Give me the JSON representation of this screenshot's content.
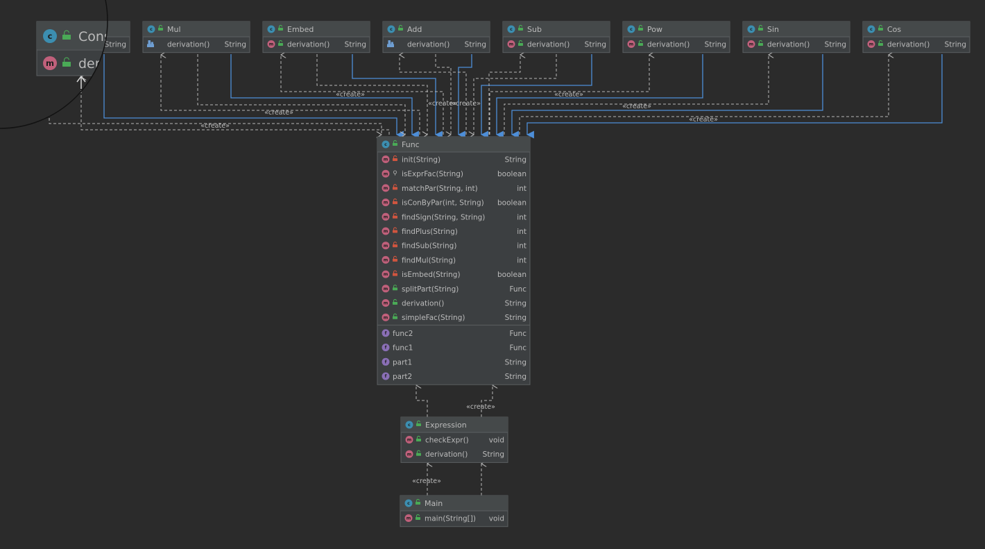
{
  "labels": {
    "create": "«create»"
  },
  "colors": {
    "background": "#2b2b2b",
    "box_bg": "#3c3f41",
    "box_header": "#45494a",
    "border": "#5b5f61",
    "text": "#bbbbbb",
    "type_text": "#bbbbbb",
    "dashed_edge": "#b7b7b7",
    "solid_edge": "#4d8ed8",
    "class_icon": "#3c8eb0",
    "method_icon": "#c0607b",
    "field_icon": "#8a6fb6",
    "public_lock": "#4aaa56",
    "private_lock": "#d0553f"
  },
  "classes": [
    {
      "id": "cons",
      "name": "Cons",
      "icon": "class-icon",
      "methods": [
        {
          "name": "der",
          "type": "String",
          "icon": "method-icon",
          "access": "public"
        }
      ],
      "fields": []
    },
    {
      "id": "mul",
      "name": "Mul",
      "icon": "class-icon",
      "methods": [
        {
          "name": "derivation()",
          "type": "String",
          "icon": "override-icon",
          "access": "none"
        }
      ],
      "fields": []
    },
    {
      "id": "embed",
      "name": "Embed",
      "icon": "class-icon",
      "methods": [
        {
          "name": "derivation()",
          "type": "String",
          "icon": "method-icon",
          "access": "public"
        }
      ],
      "fields": []
    },
    {
      "id": "add",
      "name": "Add",
      "icon": "class-icon",
      "methods": [
        {
          "name": "derivation()",
          "type": "String",
          "icon": "override-icon",
          "access": "none"
        }
      ],
      "fields": []
    },
    {
      "id": "sub",
      "name": "Sub",
      "icon": "class-icon",
      "methods": [
        {
          "name": "derivation()",
          "type": "String",
          "icon": "method-icon",
          "access": "public"
        }
      ],
      "fields": []
    },
    {
      "id": "pow",
      "name": "Pow",
      "icon": "class-icon",
      "methods": [
        {
          "name": "derivation()",
          "type": "String",
          "icon": "method-icon",
          "access": "public"
        }
      ],
      "fields": []
    },
    {
      "id": "sin",
      "name": "Sin",
      "icon": "class-icon",
      "methods": [
        {
          "name": "derivation()",
          "type": "String",
          "icon": "method-icon",
          "access": "public"
        }
      ],
      "fields": []
    },
    {
      "id": "cos",
      "name": "Cos",
      "icon": "class-icon",
      "methods": [
        {
          "name": "derivation()",
          "type": "String",
          "icon": "method-icon",
          "access": "public"
        }
      ],
      "fields": []
    },
    {
      "id": "func",
      "name": "Func",
      "icon": "class-icon",
      "methods": [
        {
          "name": "init(String)",
          "type": "String",
          "icon": "method-icon",
          "access": "private"
        },
        {
          "name": "isExprFac(String)",
          "type": "boolean",
          "icon": "method-icon",
          "access": "package"
        },
        {
          "name": "matchPar(String, int)",
          "type": "int",
          "icon": "method-icon",
          "access": "private"
        },
        {
          "name": "isConByPar(int, String)",
          "type": "boolean",
          "icon": "method-icon",
          "access": "private"
        },
        {
          "name": "findSign(String, String)",
          "type": "int",
          "icon": "method-icon",
          "access": "private"
        },
        {
          "name": "findPlus(String)",
          "type": "int",
          "icon": "method-icon",
          "access": "private"
        },
        {
          "name": "findSub(String)",
          "type": "int",
          "icon": "method-icon",
          "access": "private"
        },
        {
          "name": "findMul(String)",
          "type": "int",
          "icon": "method-icon",
          "access": "private"
        },
        {
          "name": "isEmbed(String)",
          "type": "boolean",
          "icon": "method-icon",
          "access": "private"
        },
        {
          "name": "splitPart(String)",
          "type": "Func",
          "icon": "method-icon",
          "access": "public"
        },
        {
          "name": "derivation()",
          "type": "String",
          "icon": "method-icon",
          "access": "public"
        },
        {
          "name": "simpleFac(String)",
          "type": "String",
          "icon": "method-icon",
          "access": "public"
        }
      ],
      "fields": [
        {
          "name": "func2",
          "type": "Func",
          "icon": "field-icon"
        },
        {
          "name": "func1",
          "type": "Func",
          "icon": "field-icon"
        },
        {
          "name": "part1",
          "type": "String",
          "icon": "field-icon"
        },
        {
          "name": "part2",
          "type": "String",
          "icon": "field-icon"
        }
      ]
    },
    {
      "id": "expression",
      "name": "Expression",
      "icon": "class-icon",
      "methods": [
        {
          "name": "checkExpr()",
          "type": "void",
          "icon": "method-icon",
          "access": "public"
        },
        {
          "name": "derivation()",
          "type": "String",
          "icon": "method-icon",
          "access": "public"
        }
      ],
      "fields": []
    },
    {
      "id": "main",
      "name": "Main",
      "icon": "main-class-icon",
      "methods": [
        {
          "name": "main(String[])",
          "type": "void",
          "icon": "method-icon",
          "access": "public"
        }
      ],
      "fields": []
    }
  ],
  "edges": [
    {
      "kind": "solid",
      "from": "cons",
      "to": "func",
      "label": false
    },
    {
      "kind": "dashed",
      "from": "cons",
      "to": "func",
      "label": true
    },
    {
      "kind": "dashed",
      "from": "func",
      "to": "cons",
      "label": false
    },
    {
      "kind": "solid",
      "from": "mul",
      "to": "func",
      "label": false
    },
    {
      "kind": "dashed",
      "from": "mul",
      "to": "func",
      "label": false
    },
    {
      "kind": "dashed",
      "from": "func",
      "to": "mul",
      "label": true
    },
    {
      "kind": "solid",
      "from": "embed",
      "to": "func",
      "label": false
    },
    {
      "kind": "dashed",
      "from": "embed",
      "to": "func",
      "label": false
    },
    {
      "kind": "dashed",
      "from": "func",
      "to": "embed",
      "label": true
    },
    {
      "kind": "solid",
      "from": "add",
      "to": "func",
      "label": false
    },
    {
      "kind": "dashed",
      "from": "add",
      "to": "func",
      "label": true
    },
    {
      "kind": "dashed",
      "from": "func",
      "to": "add",
      "label": false
    },
    {
      "kind": "solid",
      "from": "sub",
      "to": "func",
      "label": false
    },
    {
      "kind": "dashed",
      "from": "sub",
      "to": "func",
      "label": true
    },
    {
      "kind": "dashed",
      "from": "func",
      "to": "sub",
      "label": false
    },
    {
      "kind": "solid",
      "from": "pow",
      "to": "func",
      "label": false
    },
    {
      "kind": "dashed",
      "from": "func",
      "to": "pow",
      "label": true
    },
    {
      "kind": "solid",
      "from": "sin",
      "to": "func",
      "label": false
    },
    {
      "kind": "dashed",
      "from": "func",
      "to": "sin",
      "label": true
    },
    {
      "kind": "solid",
      "from": "cos",
      "to": "func",
      "label": false
    },
    {
      "kind": "dashed",
      "from": "func",
      "to": "cos",
      "label": true
    },
    {
      "kind": "dashed",
      "from": "expression",
      "to": "func",
      "label": false
    },
    {
      "kind": "dashed",
      "from": "expression",
      "to": "func",
      "label": true
    },
    {
      "kind": "dashed",
      "from": "main",
      "to": "expression",
      "label": true
    },
    {
      "kind": "dashed",
      "from": "main",
      "to": "expression",
      "label": false
    }
  ]
}
